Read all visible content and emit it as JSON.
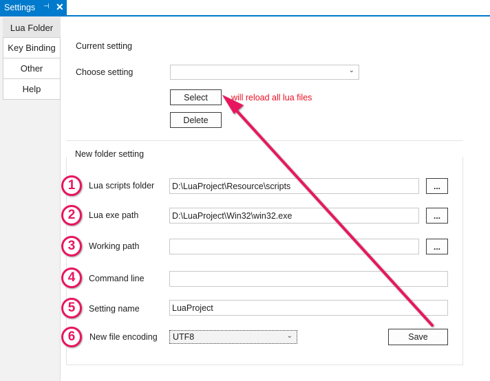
{
  "window": {
    "title": "Settings",
    "pin_glyph": "⊣",
    "close_glyph": "✕"
  },
  "nav": {
    "items": [
      {
        "label": "Lua Folder",
        "active": true
      },
      {
        "label": "Key Binding"
      },
      {
        "label": "Other"
      },
      {
        "label": "Help"
      }
    ]
  },
  "current": {
    "heading": "Current setting",
    "choose_label": "Choose setting",
    "choose_value": "",
    "select_button": "Select",
    "reload_note": "will reload all lua files",
    "reload_note_color": "#e81123",
    "delete_button": "Delete"
  },
  "new_folder": {
    "heading": "New folder setting",
    "rows": [
      {
        "num": "1",
        "label": "Lua scripts folder",
        "value": "D:\\LuaProject\\Resource\\scripts",
        "browse": "..."
      },
      {
        "num": "2",
        "label": "Lua exe path",
        "value": "D:\\LuaProject\\Win32\\win32.exe",
        "browse": "..."
      },
      {
        "num": "3",
        "label": "Working path",
        "value": "",
        "browse": "..."
      },
      {
        "num": "4",
        "label": "Command line",
        "value": ""
      },
      {
        "num": "5",
        "label": "Setting name",
        "value": "LuaProject"
      },
      {
        "num": "6",
        "label": "New file encoding",
        "value": "UTF8"
      }
    ],
    "save_button": "Save"
  },
  "annotation": {
    "arrow_color": "#e8155f"
  }
}
